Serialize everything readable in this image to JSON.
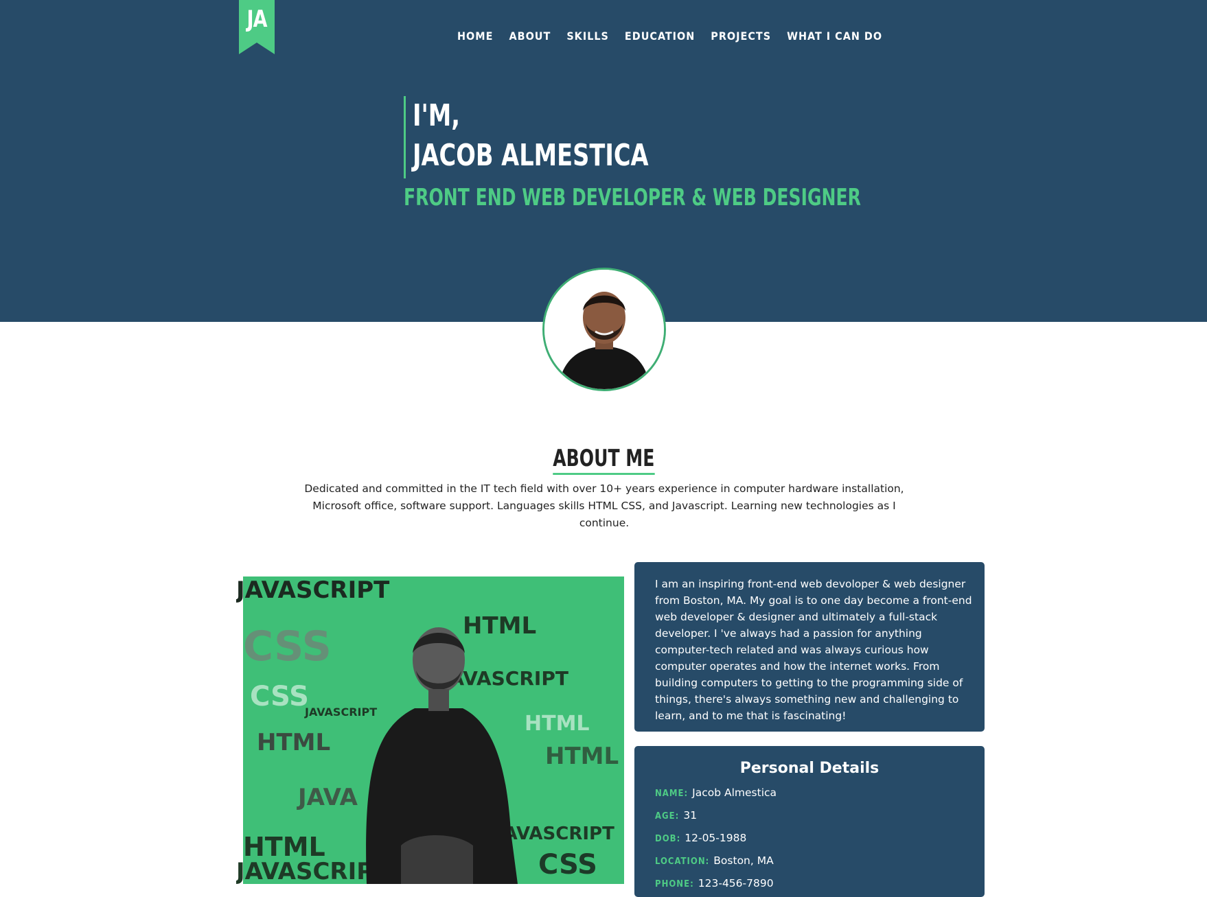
{
  "colors": {
    "primary": "#274b68",
    "accent": "#4ecb85",
    "text": "#222222",
    "white": "#ffffff"
  },
  "logo": {
    "text": "JA"
  },
  "nav": [
    "HOME",
    "ABOUT",
    "SKILLS",
    "EDUCATION",
    "PROJECTS",
    "WHAT I CAN DO"
  ],
  "hero": {
    "line1": "I'M,",
    "line2": "JACOB ALMESTICA",
    "subtitle": "FRONT END WEB DEVELOPER & WEB DESIGNER"
  },
  "about": {
    "title": "ABOUT ME",
    "text": "Dedicated and committed in the IT tech field with over 10+ years experience in computer hardware installation, Microsoft office, software support. Languages skills HTML CSS, and Javascript. Learning new technologies as I continue."
  },
  "bio": {
    "text": "I am an inspiring front-end web devoloper & web designer from Boston, MA. My goal is to one day become a front-end web developer & designer and ultimately a full-stack developer. I 've always had a passion for anything computer-tech related and was always curious how computer operates and how the internet works. From building computers to getting to the programming side of things, there's always something new and challenging to learn, and to me that is fascinating!"
  },
  "details": {
    "title": "Personal Details",
    "rows": [
      {
        "label": "NAME:",
        "value": "Jacob Almestica"
      },
      {
        "label": "AGE:",
        "value": "31"
      },
      {
        "label": "DOB:",
        "value": "12-05-1988"
      },
      {
        "label": "LOCATION:",
        "value": "Boston, MA"
      },
      {
        "label": "PHONE:",
        "value": "123-456-7890"
      }
    ]
  },
  "collage_words": [
    "JAVASCRIPT",
    "HTML",
    "CSS",
    "JAVASCRIPT",
    "HTML",
    "CSS",
    "JAVASCRIPT",
    "HTML",
    "JAVA",
    "JAVASCRIPT",
    "HTML",
    "CSS",
    "JAVASCRIPT",
    "HTML"
  ]
}
